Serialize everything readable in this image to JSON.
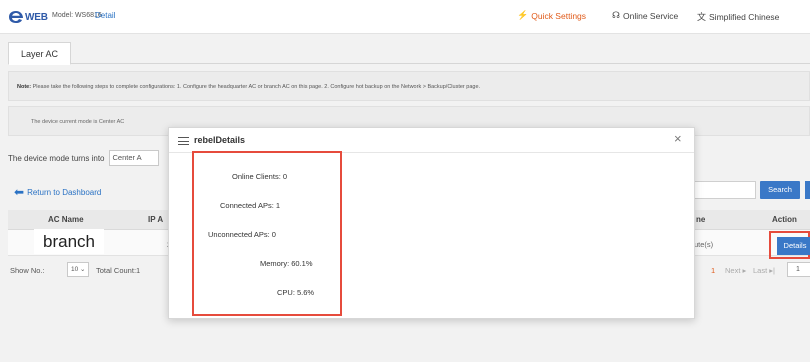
{
  "header": {
    "logo_text": "WEB",
    "model": "Model: WS6816",
    "detail_link": "Detail",
    "nav": [
      {
        "icon": "lightning-icon",
        "label": "Quick Settings"
      },
      {
        "icon": "headset-icon",
        "label": "Online Service"
      },
      {
        "icon": "language-icon",
        "label": "Simplified Chinese"
      }
    ]
  },
  "tabs": [
    {
      "label": "Layer AC"
    }
  ],
  "note": {
    "prefix": "Note:",
    "text": "Please take the following steps to complete configurations: 1. Configure the headquarter AC or branch AC on this page. 2. Configure hot backup on the Network > Backup/Cluster page."
  },
  "mode_info": "The device current mode is Center AC",
  "mode_row": {
    "label": "The device mode turns into",
    "selected": "Center A"
  },
  "return_link": "Return to Dashboard",
  "search": {
    "button_label": "Search"
  },
  "table": {
    "columns": [
      "AC Name",
      "IP A",
      "ne",
      "Action"
    ],
    "rows": [
      {
        "ac_name": "branch",
        "ip": "2.",
        "route": "ute(s)",
        "action": "Details"
      }
    ]
  },
  "pager": {
    "show_label": "Show No.:",
    "page_size": "10",
    "total": "Total Count:1",
    "current_page": "1",
    "next": "Next",
    "last": "Last",
    "goto_value": "1"
  },
  "modal": {
    "title": "rebelDetails",
    "stats": [
      "Online Clients: 0",
      "Connected APs: 1",
      "Unconnected APs: 0",
      "Memory: 60.1%",
      "CPU: 5.6%"
    ]
  },
  "colors": {
    "accent_orange": "#e05a19",
    "link_blue": "#2a72c4",
    "button_blue": "#3a78c7",
    "highlight_red": "#e64b3c"
  }
}
